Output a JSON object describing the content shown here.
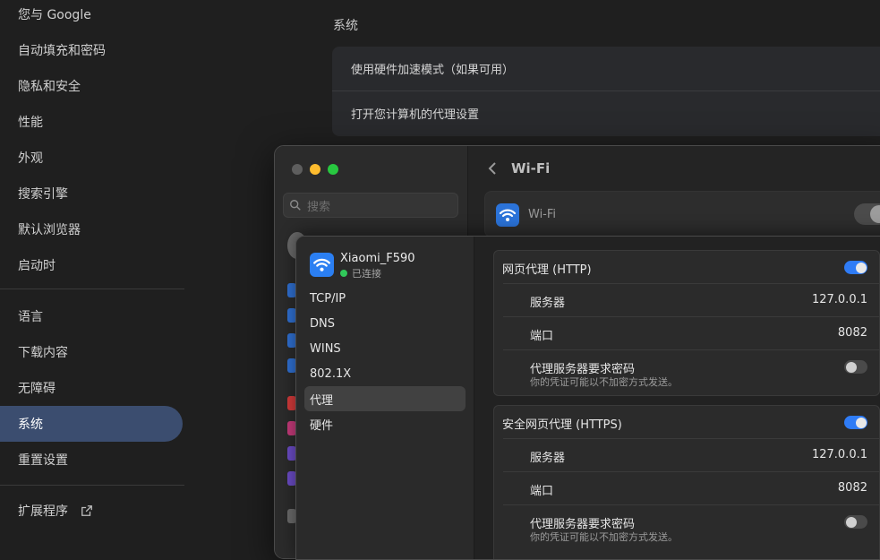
{
  "chrome_sidebar": {
    "items": [
      {
        "label": "您与 Google"
      },
      {
        "label": "自动填充和密码"
      },
      {
        "label": "隐私和安全"
      },
      {
        "label": "性能"
      },
      {
        "label": "外观"
      },
      {
        "label": "搜索引擎"
      },
      {
        "label": "默认浏览器"
      },
      {
        "label": "启动时"
      },
      {
        "label": "语言"
      },
      {
        "label": "下载内容"
      },
      {
        "label": "无障碍"
      },
      {
        "label": "系统",
        "active": true
      },
      {
        "label": "重置设置"
      },
      {
        "label": "扩展程序",
        "icon": "external-link-icon"
      }
    ]
  },
  "chrome_main": {
    "section_title": "系统",
    "rows": [
      {
        "label": "使用硬件加速模式（如果可用）"
      },
      {
        "label": "打开您计算机的代理设置"
      }
    ]
  },
  "mac_window": {
    "search_placeholder": "搜索",
    "title": "Wi-Fi",
    "wifi_row_label": "Wi-Fi"
  },
  "network_sheet": {
    "network_name": "Xiaomi_F590",
    "status": "已连接",
    "tabs": [
      "TCP/IP",
      "DNS",
      "WINS",
      "802.1X",
      "代理",
      "硬件"
    ],
    "active_tab": "代理",
    "proxies": [
      {
        "title": "网页代理 (HTTP)",
        "enabled": true,
        "server_label": "服务器",
        "server": "127.0.0.1",
        "port_label": "端口",
        "port": "8082",
        "auth_label": "代理服务器要求密码",
        "auth_note": "你的凭证可能以不加密方式发送。",
        "auth_enabled": false
      },
      {
        "title": "安全网页代理 (HTTPS)",
        "enabled": true,
        "server_label": "服务器",
        "server": "127.0.0.1",
        "port_label": "端口",
        "port": "8082",
        "auth_label": "代理服务器要求密码",
        "auth_note": "你的凭证可能以不加密方式发送。",
        "auth_enabled": false
      }
    ]
  },
  "colors": {
    "accent": "#2f7cf6",
    "active_nav": "#3b4d6f",
    "status_connected": "#31c85a",
    "traffic_close": "#5e5e5e",
    "traffic_minimize": "#febc2e",
    "traffic_zoom": "#28c840"
  }
}
